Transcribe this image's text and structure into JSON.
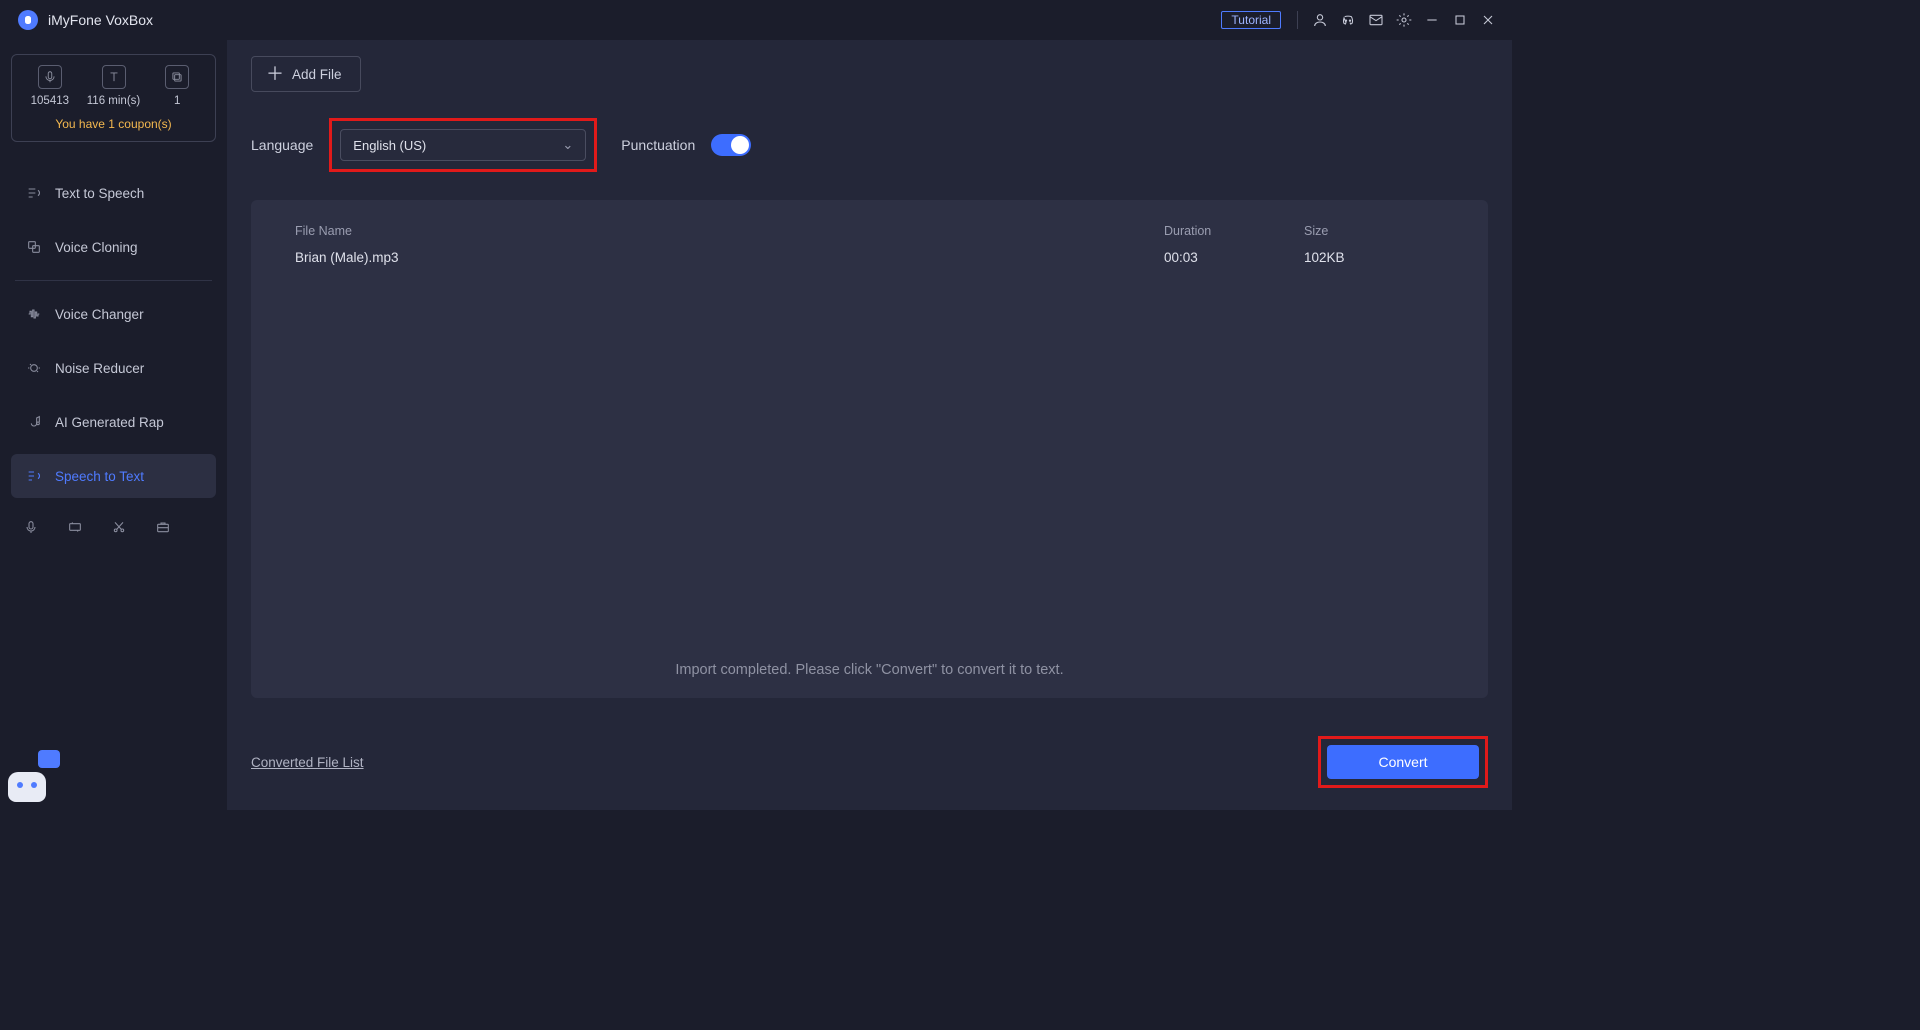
{
  "titlebar": {
    "app_name": "iMyFone VoxBox",
    "tutorial_label": "Tutorial"
  },
  "sidebar": {
    "stats": [
      {
        "value": "105413"
      },
      {
        "value": "116 min(s)"
      },
      {
        "value": "1"
      }
    ],
    "coupon_text": "You have 1 coupon(s)",
    "items": [
      {
        "id": "text-to-speech",
        "label": "Text to Speech"
      },
      {
        "id": "voice-cloning",
        "label": "Voice Cloning"
      },
      {
        "id": "voice-changer",
        "label": "Voice Changer"
      },
      {
        "id": "noise-reducer",
        "label": "Noise Reducer"
      },
      {
        "id": "ai-generated-rap",
        "label": "AI Generated Rap"
      },
      {
        "id": "speech-to-text",
        "label": "Speech to Text"
      }
    ]
  },
  "main": {
    "add_file_label": "Add File",
    "language_label": "Language",
    "language_value": "English (US)",
    "punctuation_label": "Punctuation",
    "punctuation_on": true,
    "columns": {
      "name": "File Name",
      "duration": "Duration",
      "size": "Size"
    },
    "files": [
      {
        "name": "Brian (Male).mp3",
        "duration": "00:03",
        "size": "102KB"
      }
    ],
    "import_msg": "Import completed. Please click \"Convert\" to convert it to text.",
    "converted_link": "Converted File List",
    "convert_label": "Convert"
  },
  "colors": {
    "accent": "#3d6dff",
    "highlight_box": "#e11a1a"
  }
}
